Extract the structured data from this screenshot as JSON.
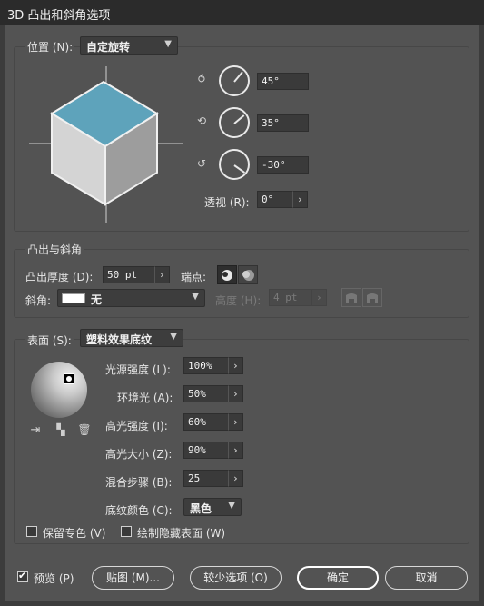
{
  "window": {
    "title": "3D 凸出和斜角选项"
  },
  "position": {
    "label": "位置 (N):",
    "preset": "自定旋转",
    "x_value": "45°",
    "y_value": "35°",
    "z_value": "-30°",
    "perspective_label": "透视 (R):",
    "perspective_value": "0°"
  },
  "extrude": {
    "section_label": "凸出与斜角",
    "depth_label": "凸出厚度 (D):",
    "depth_value": "50 pt",
    "cap_label": "端点:",
    "bevel_label": "斜角:",
    "bevel_value": "无",
    "height_label": "高度 (H):",
    "height_value": "4 pt"
  },
  "surface": {
    "label": "表面 (S):",
    "value": "塑料效果底纹",
    "light_intensity_label": "光源强度 (L):",
    "light_intensity": "100%",
    "ambient_label": "环境光 (A):",
    "ambient": "50%",
    "highlight_intensity_label": "高光强度 (I):",
    "highlight_intensity": "60%",
    "highlight_size_label": "高光大小 (Z):",
    "highlight_size": "90%",
    "blend_steps_label": "混合步骤 (B):",
    "blend_steps": "25",
    "shade_color_label": "底纹颜色 (C):",
    "shade_color": "黑色",
    "preserve_spot_label": "保留专色 (V)",
    "draw_hidden_label": "绘制隐藏表面 (W)"
  },
  "footer": {
    "preview_label": "预览 (P)",
    "map_button": "贴图 (M)...",
    "fewer_options_button": "较少选项 (O)",
    "ok_button": "确定",
    "cancel_button": "取消"
  }
}
